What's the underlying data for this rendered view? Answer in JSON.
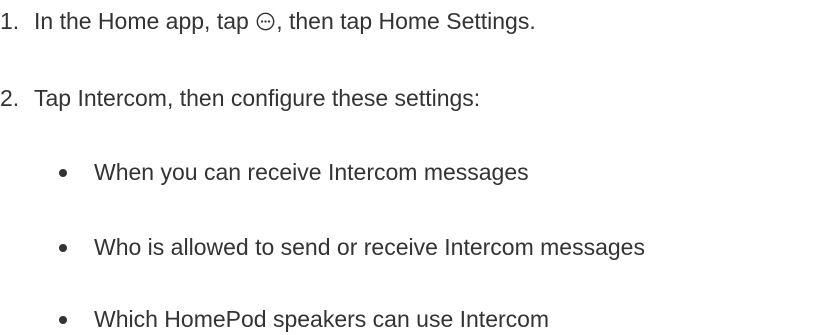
{
  "steps": [
    {
      "number": "1.",
      "text_before_icon": "In the Home app, tap ",
      "icon": "more-ellipsis-circle-icon",
      "text_after_icon": ", then tap Home Settings."
    },
    {
      "number": "2.",
      "text": "Tap Intercom, then configure these settings:"
    }
  ],
  "settings": [
    "When you can receive Intercom messages",
    "Who is allowed to send or receive Intercom messages",
    "Which HomePod speakers can use Intercom"
  ]
}
